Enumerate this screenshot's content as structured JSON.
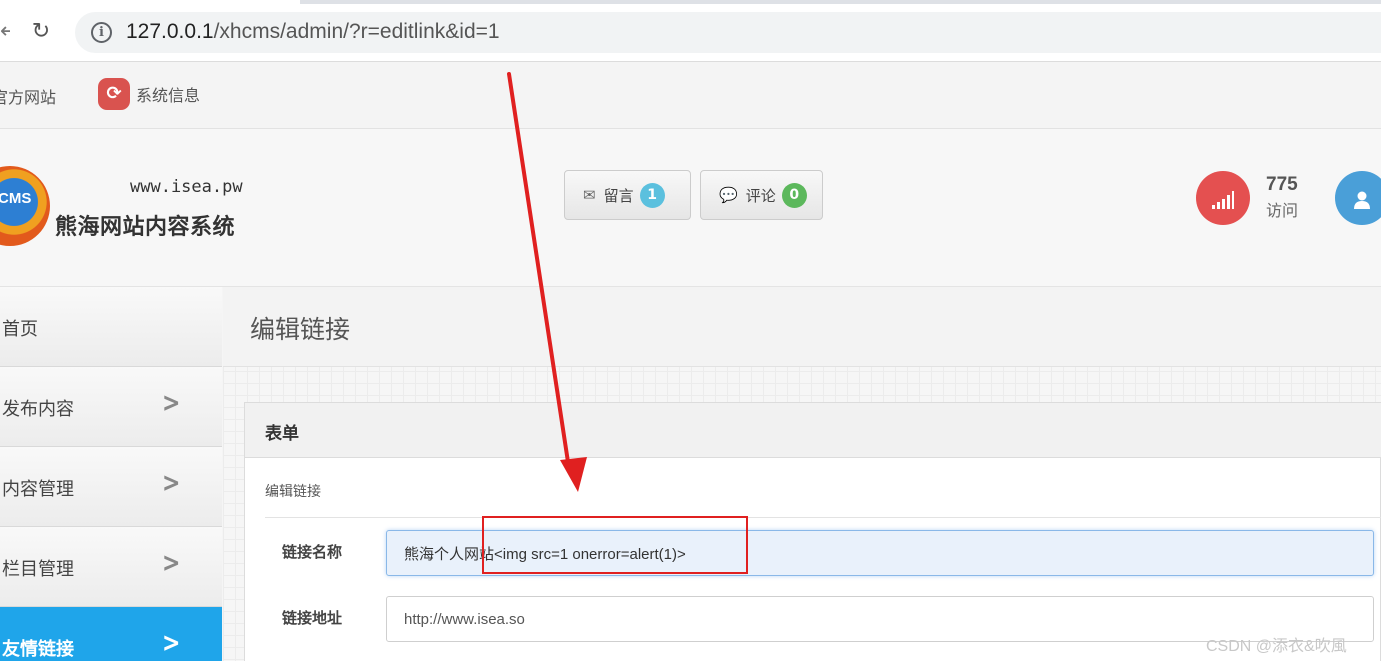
{
  "browser": {
    "url_host": "127.0.0.1",
    "url_path": "/xhcms/admin/?r=editlink&id=1"
  },
  "top_links": {
    "official_site": "官方网站",
    "system_info": "系统信息"
  },
  "brand": {
    "logo_text": "CMS",
    "site_url": "www.isea.pw",
    "site_name": "熊海网站内容系统"
  },
  "header": {
    "messages_label": "留言",
    "messages_count": "1",
    "comments_label": "评论",
    "comments_count": "0",
    "visits_count": "775",
    "visits_label": "访问"
  },
  "sidebar": {
    "items": [
      {
        "label": "首页",
        "active": false
      },
      {
        "label": "发布内容",
        "active": false
      },
      {
        "label": "内容管理",
        "active": false
      },
      {
        "label": "栏目管理",
        "active": false
      },
      {
        "label": "友情链接",
        "active": true
      }
    ]
  },
  "main": {
    "page_title": "编辑链接",
    "panel_title": "表单",
    "legend": "编辑链接",
    "fields": {
      "name_label": "链接名称",
      "name_value": "熊海个人网站<img src=1 onerror=alert(1)>",
      "url_label": "链接地址",
      "url_value": "http://www.isea.so"
    }
  },
  "watermark": "CSDN @添衣&吹風",
  "colors": {
    "active_nav": "#1fa5ea",
    "annotation": "#e02020",
    "badge_messages": "#5bc0de",
    "badge_comments": "#5cb85c",
    "visits_icon": "#e45050",
    "user_icon": "#4a9fd8"
  },
  "icons": {
    "reload": "reload-icon",
    "info": "info-icon",
    "refresh": "refresh-icon",
    "envelope": "envelope-icon",
    "comment": "comment-icon",
    "signal": "signal-icon",
    "user": "user-icon",
    "chevron": "chevron-right-icon"
  }
}
